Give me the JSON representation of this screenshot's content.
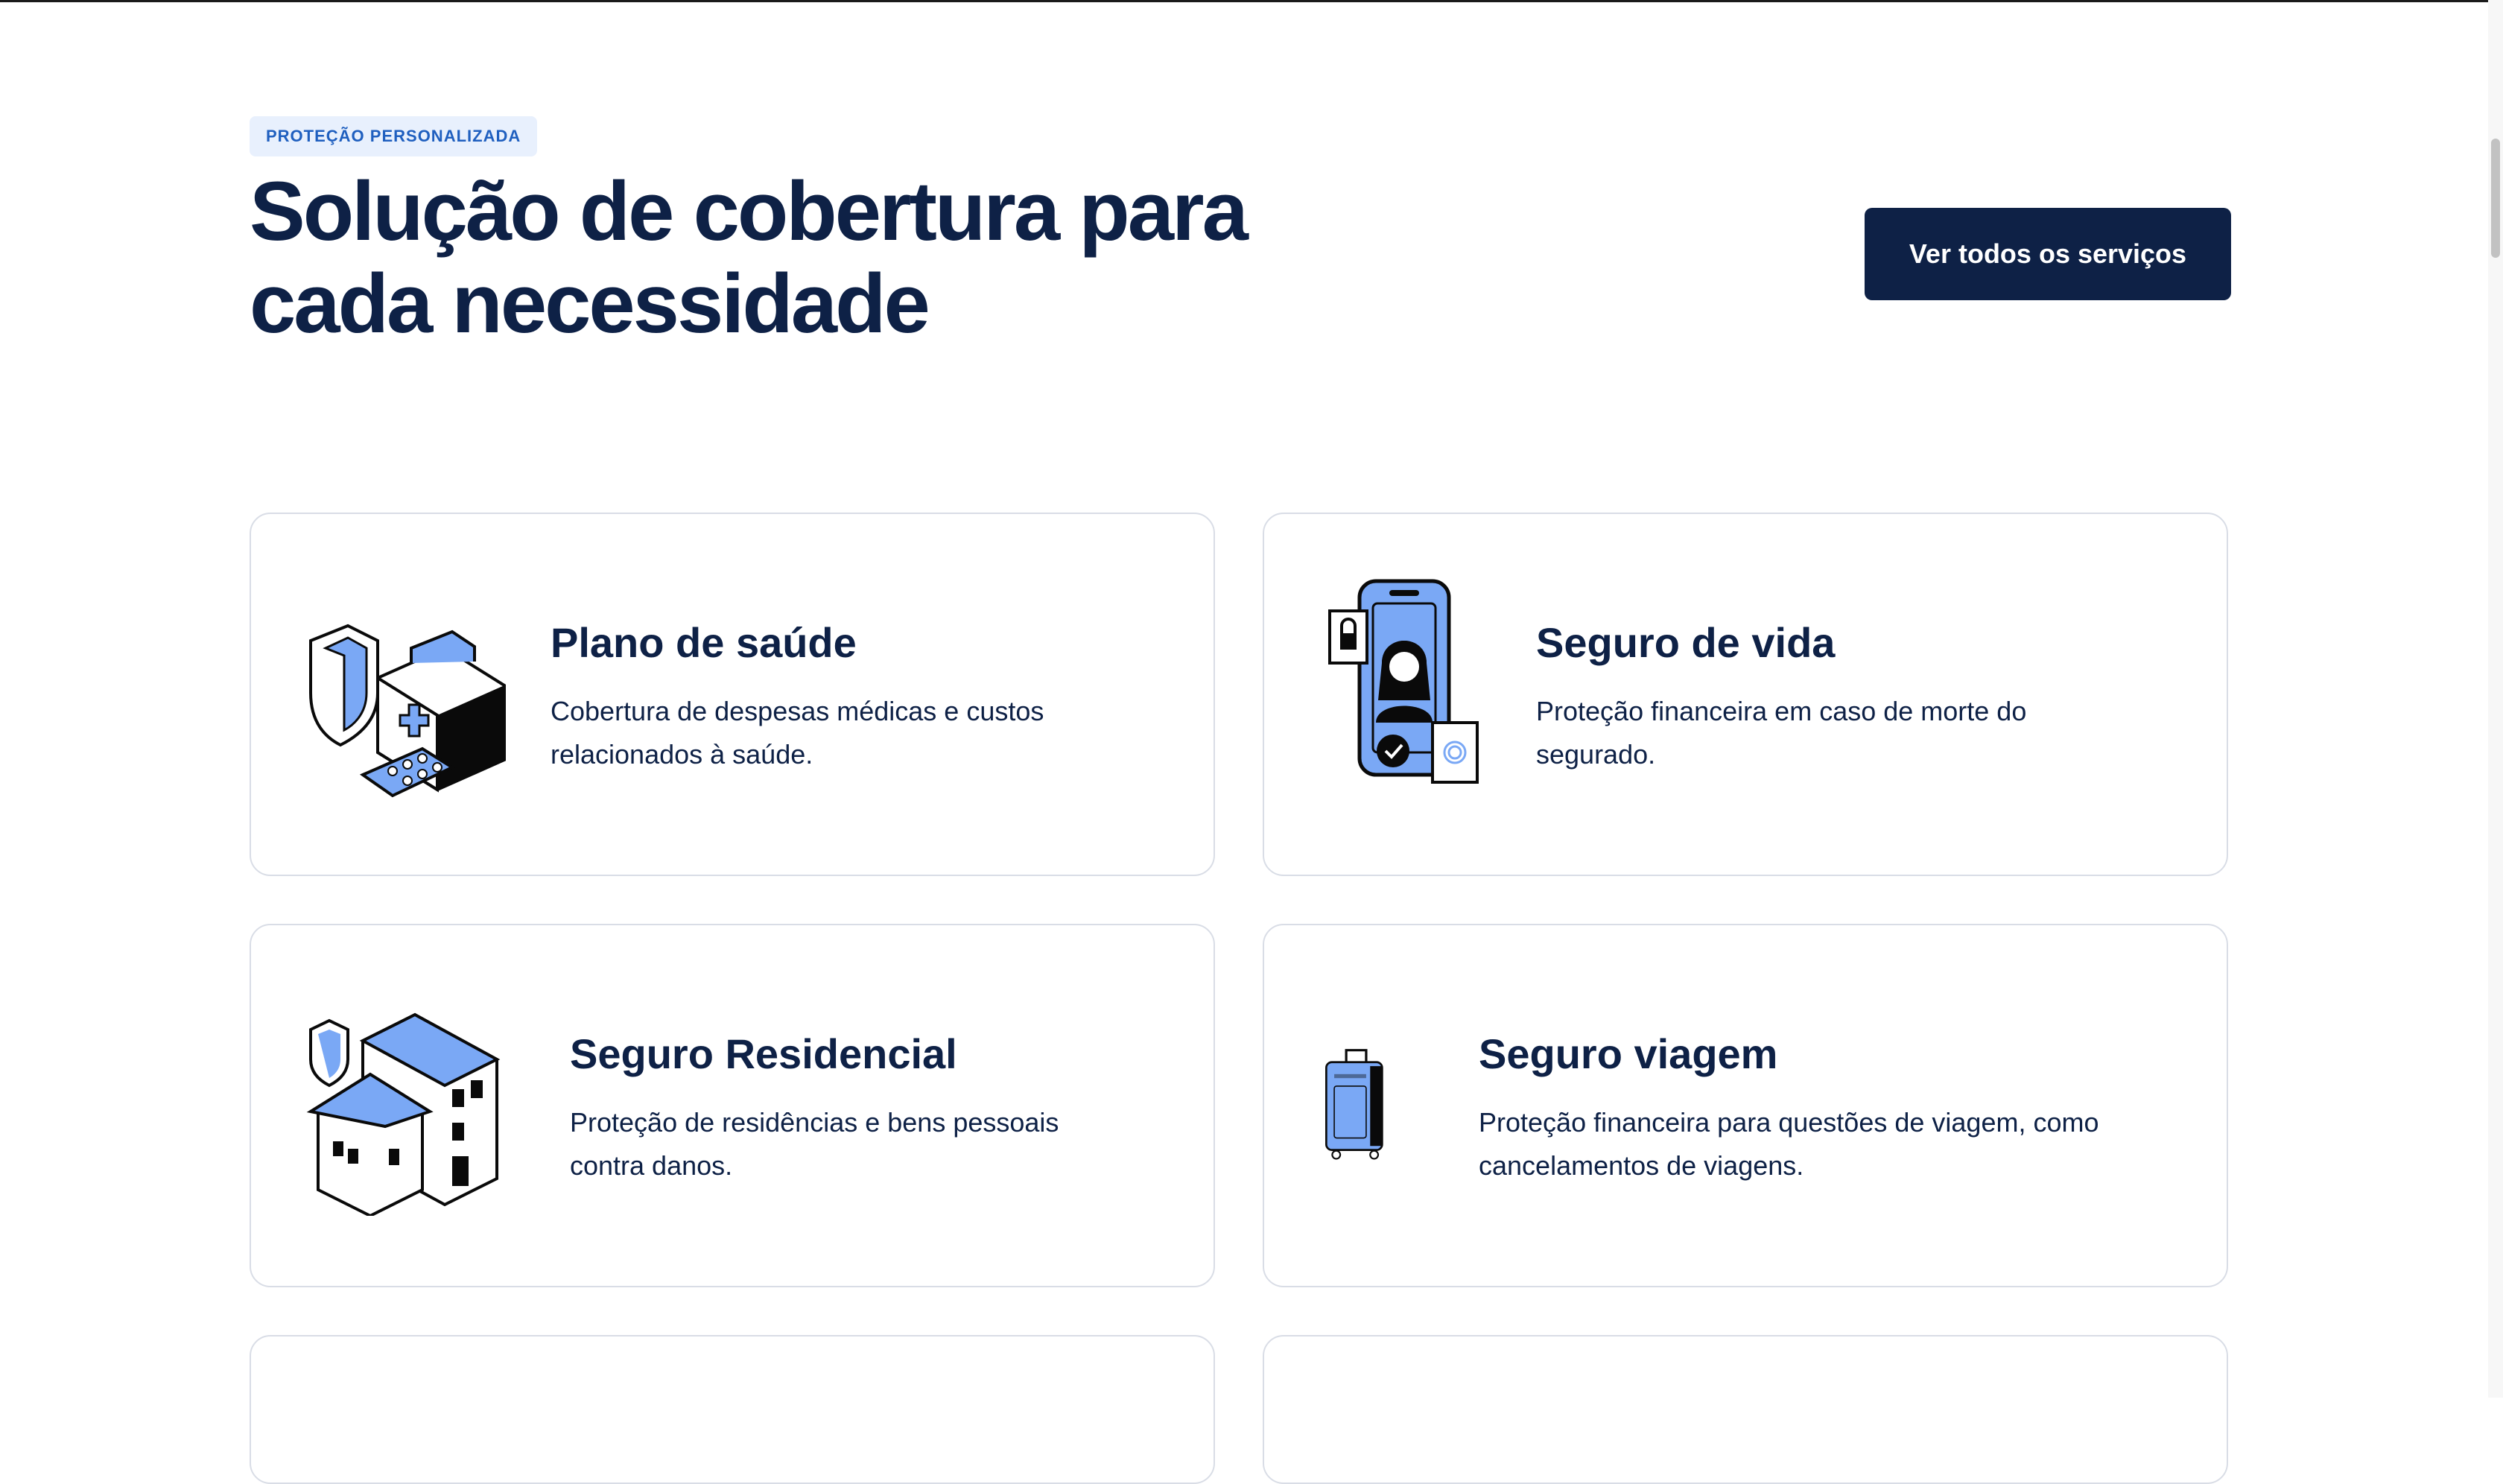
{
  "section": {
    "eyebrow": "PROTEÇÃO PERSONALIZADA",
    "headline_line1": "Solução de cobertura para",
    "headline_line2": "cada necessidade",
    "cta_label": "Ver todos os serviços"
  },
  "cards": [
    {
      "title": "Plano de saúde",
      "description": "Cobertura de despesas médicas e custos relacionados à saúde.",
      "icon": "medical-kit-icon"
    },
    {
      "title": "Seguro de vida",
      "description": "Proteção financeira em caso de morte do segurado.",
      "icon": "phone-identity-icon"
    },
    {
      "title": "Seguro Residencial",
      "description": "Proteção de residências e bens pessoais contra danos.",
      "icon": "houses-icon"
    },
    {
      "title": "Seguro viagem",
      "description": "Proteção financeira para questões de viagem, como cancelamentos de viagens.",
      "icon": "luggage-icon"
    }
  ],
  "colors": {
    "navy": "#0e2146",
    "accent_blue": "#7aa8f5",
    "eyebrow_bg": "#e8f0fd",
    "eyebrow_text": "#1f5fbf",
    "card_border": "#d9dde6"
  }
}
